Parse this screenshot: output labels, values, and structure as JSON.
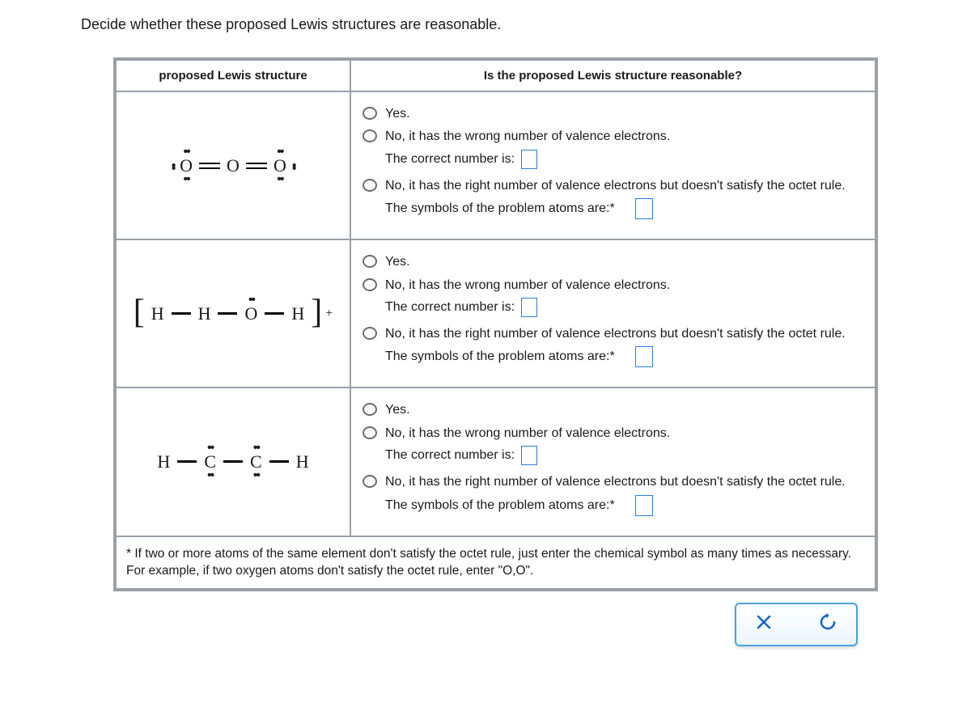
{
  "prompt": "Decide whether these proposed Lewis structures are reasonable.",
  "headers": {
    "left": "proposed Lewis structure",
    "right": "Is the proposed Lewis structure reasonable?"
  },
  "options": {
    "yes": "Yes.",
    "wrong_count": "No, it has the wrong number of valence electrons.",
    "correct_number_label": "The correct number is:",
    "octet": "No, it has the right number of valence electrons but doesn't satisfy the octet rule.",
    "problem_atoms_label": "The symbols of the problem atoms are:*"
  },
  "rows": [
    {
      "structure": {
        "type": "ozone",
        "atoms": [
          "O",
          "O",
          "O"
        ],
        "bonds": [
          "double",
          "double"
        ],
        "lone_pairs": {
          "left": [
            "top",
            "bot",
            "left"
          ],
          "center": [],
          "right": [
            "top",
            "bot",
            "right"
          ]
        }
      }
    },
    {
      "structure": {
        "type": "bracket-cation",
        "atoms": [
          "H",
          "H",
          "O",
          "H"
        ],
        "bonds": [
          "single",
          "single",
          "single"
        ],
        "lone_pairs": {
          "2": [
            "top"
          ]
        },
        "charge": "+"
      }
    },
    {
      "structure": {
        "type": "chain",
        "atoms": [
          "H",
          "C",
          "C",
          "H"
        ],
        "bonds": [
          "single",
          "single",
          "single"
        ],
        "lone_pairs": {
          "1": [
            "top",
            "bot"
          ],
          "2": [
            "top",
            "bot"
          ]
        }
      }
    }
  ],
  "footnote": "* If two or more atoms of the same element don't satisfy the octet rule, just enter the chemical symbol as many times as necessary. For example, if two oxygen atoms don't satisfy the octet rule, enter \"O,O\".",
  "toolbar": {
    "clear": "×",
    "reset": "↺"
  }
}
